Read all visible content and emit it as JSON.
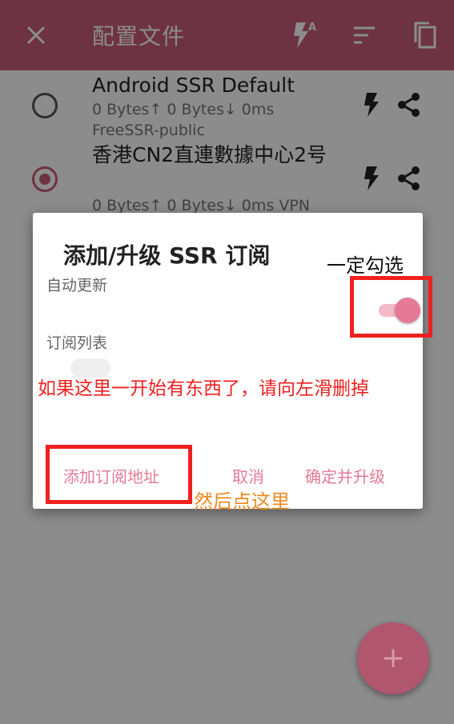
{
  "appbar": {
    "title": "配置文件",
    "icons": [
      "close-icon",
      "auto-flash-icon",
      "sort-icon",
      "copy-icon"
    ]
  },
  "profiles": [
    {
      "name": "Android SSR Default",
      "stats": "0 Bytes↑  0 Bytes↓  0ms",
      "group": "FreeSSR-public",
      "selected": false
    },
    {
      "name": "香港CN2直連數據中心2号",
      "stats": "0 Bytes↑  0 Bytes↓  0ms  VPN",
      "selected": true
    }
  ],
  "dialog": {
    "title": "添加/升级 SSR 订阅",
    "auto_update_label": "自动更新",
    "auto_update_on": true,
    "sub_list_label": "订阅列表",
    "buttons": {
      "add": "添加订阅地址",
      "cancel": "取消",
      "confirm": "确定并升级"
    }
  },
  "annotations": {
    "must_check": "一定勾选",
    "swipe_note": "如果这里一开始有东西了，请向左滑删掉",
    "then_click": "然后点这里"
  },
  "fab": {
    "symbol": "+"
  },
  "colors": {
    "primary": "#c75c7a",
    "accent": "#e57a98",
    "annotation_red": "#ef2020",
    "annotation_orange": "#ee8a22"
  }
}
